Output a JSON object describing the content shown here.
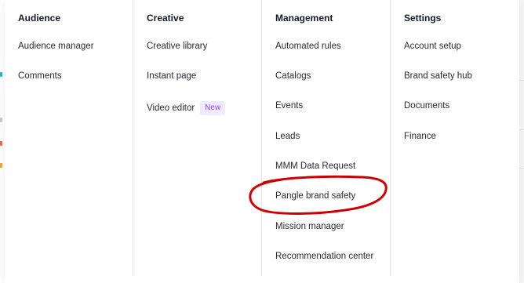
{
  "columns": [
    {
      "title": "Audience",
      "items": [
        {
          "label": "Audience manager"
        },
        {
          "label": "Comments"
        }
      ]
    },
    {
      "title": "Creative",
      "items": [
        {
          "label": "Creative library"
        },
        {
          "label": "Instant page"
        },
        {
          "label": "Video editor",
          "badge": "New"
        }
      ]
    },
    {
      "title": "Management",
      "items": [
        {
          "label": "Automated rules"
        },
        {
          "label": "Catalogs"
        },
        {
          "label": "Events"
        },
        {
          "label": "Leads"
        },
        {
          "label": "MMM Data Request"
        },
        {
          "label": "Pangle brand safety"
        },
        {
          "label": "Mission manager"
        },
        {
          "label": "Recommendation center"
        }
      ]
    },
    {
      "title": "Settings",
      "items": [
        {
          "label": "Account setup"
        },
        {
          "label": "Brand safety hub"
        },
        {
          "label": "Documents"
        },
        {
          "label": "Finance"
        }
      ]
    }
  ],
  "colors": {
    "badge_bg": "#f0e9ff",
    "badge_text": "#8a4fe6",
    "annotation": "#cc0000"
  }
}
